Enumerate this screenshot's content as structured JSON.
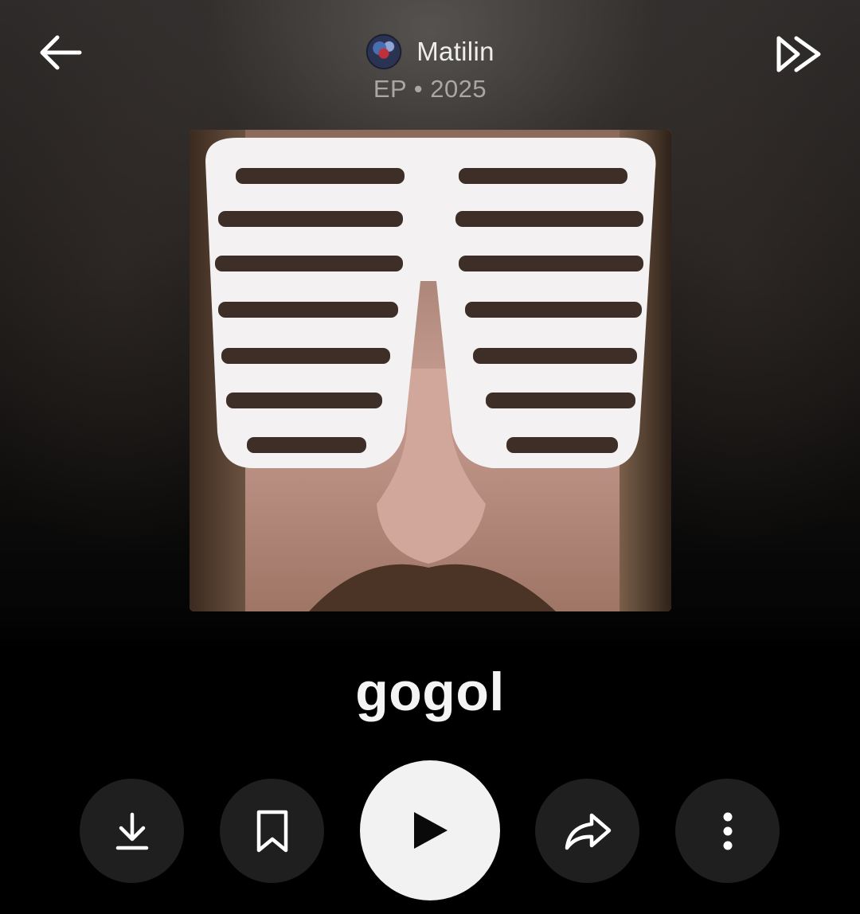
{
  "header": {
    "artist_name": "Matilin",
    "meta": "EP • 2025",
    "back_icon": "arrow-left-icon",
    "next_icon": "double-chevron-right-icon"
  },
  "album": {
    "title": "gogol",
    "cover_description_icon": "album-cover"
  },
  "actions": {
    "download_icon": "download-icon",
    "save_icon": "bookmark-icon",
    "play_icon": "play-icon",
    "share_icon": "share-icon",
    "more_icon": "more-vertical-icon"
  },
  "colors": {
    "background_top": "#2e2b2a",
    "background_bottom": "#000000",
    "action_button_bg": "#1f1f1f",
    "play_button_bg": "#f2f2f2",
    "meta_text": "#a9a6a4"
  }
}
